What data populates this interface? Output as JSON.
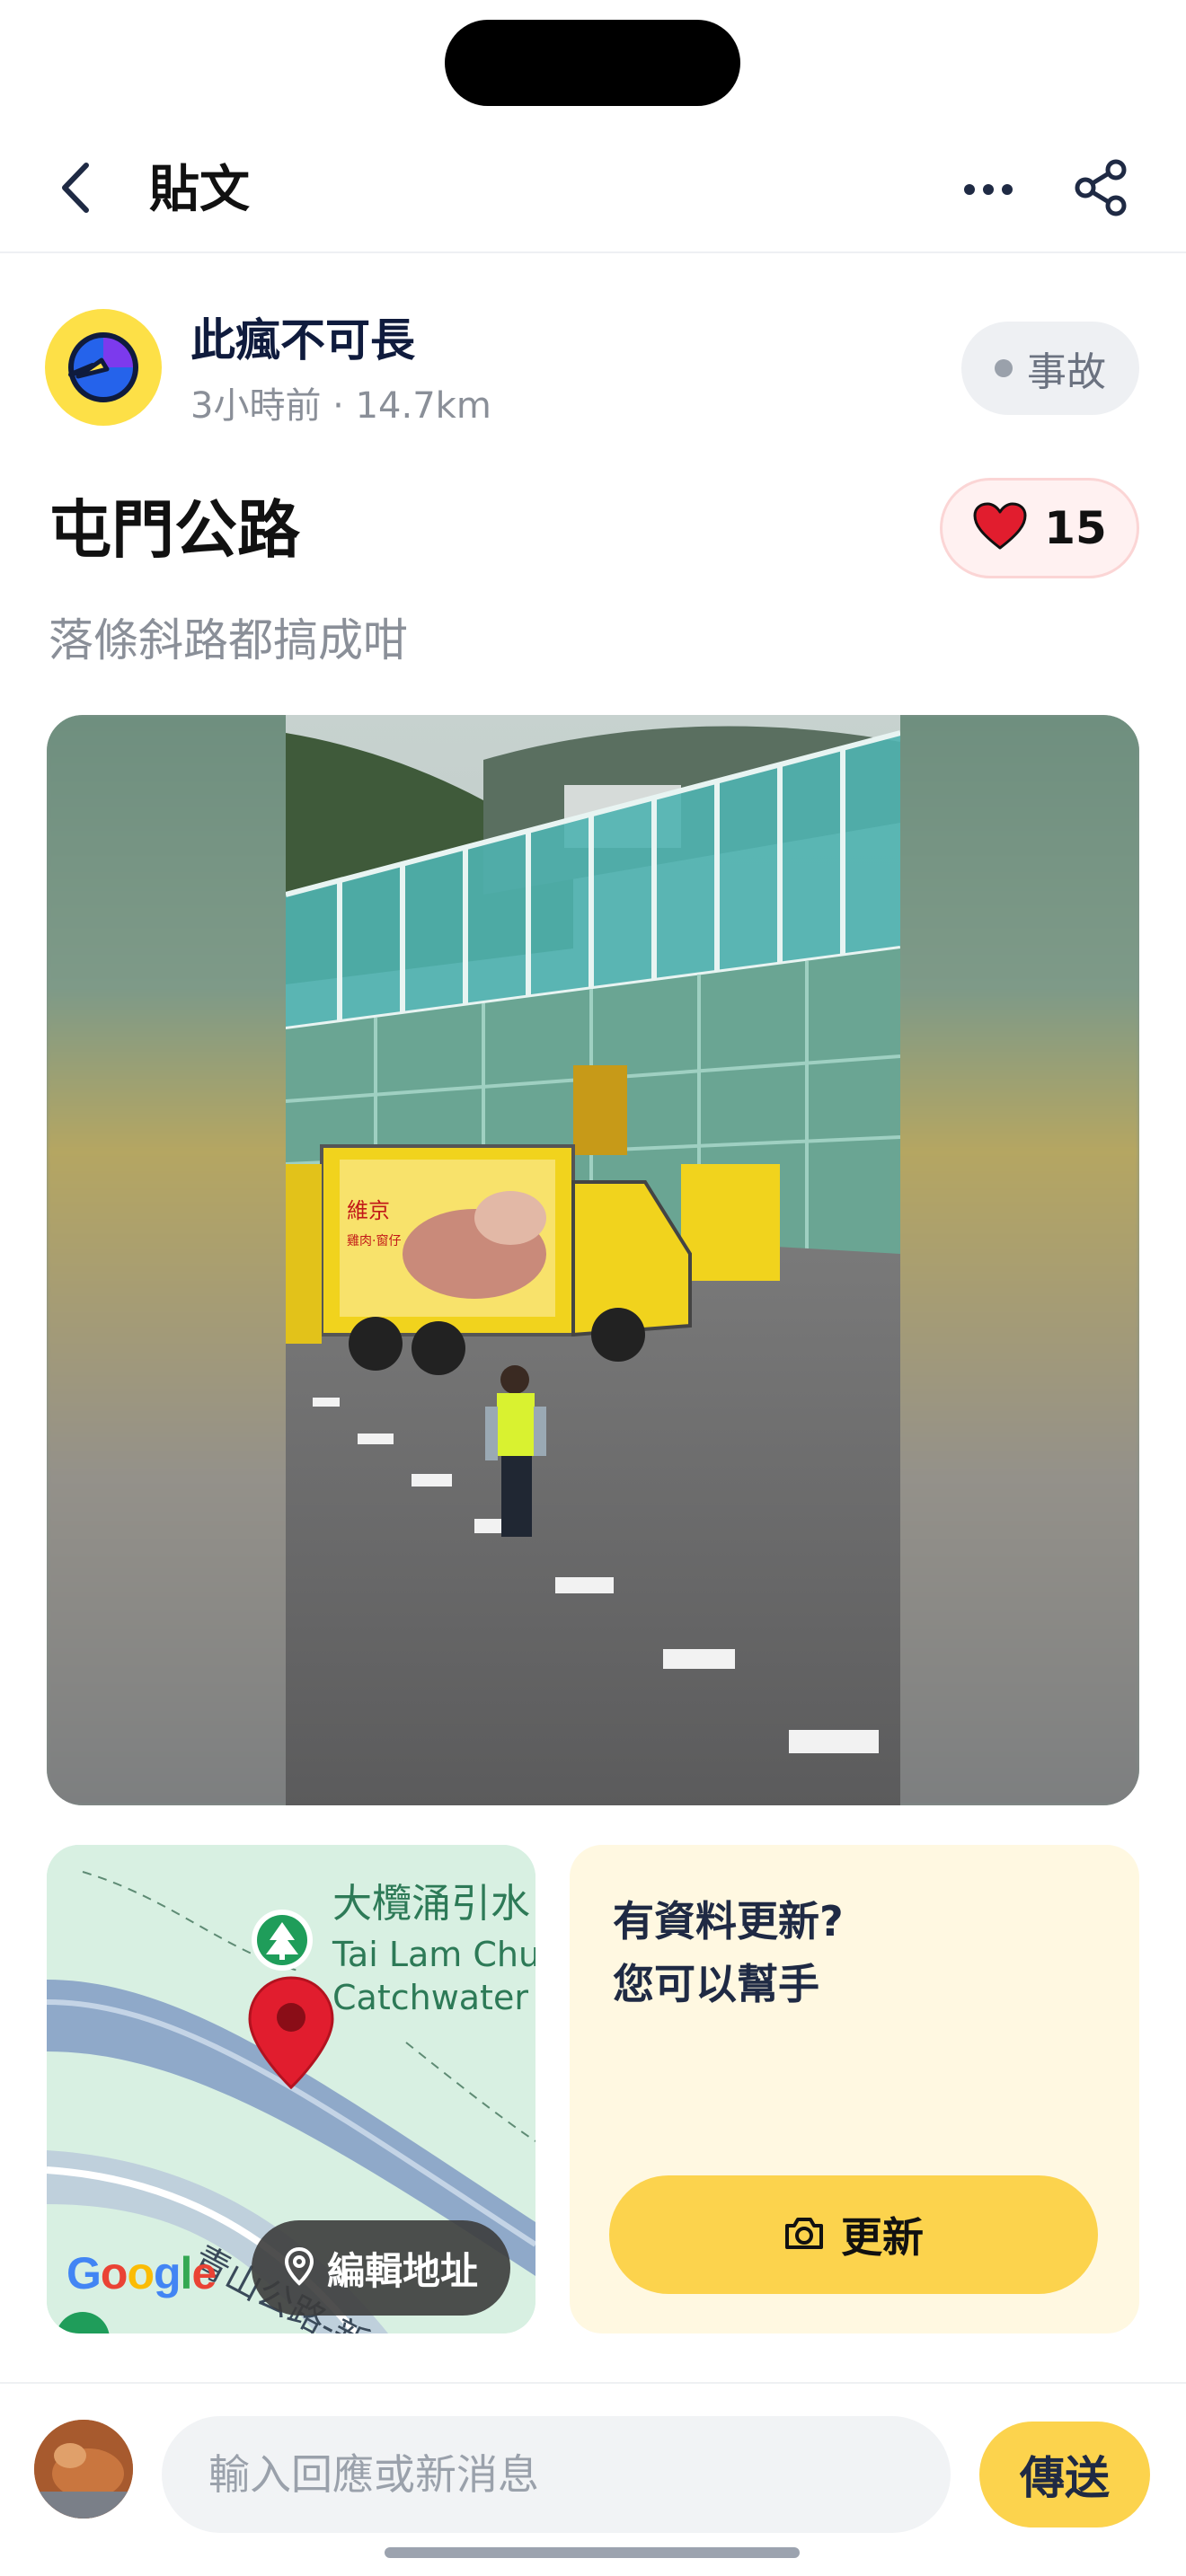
{
  "header": {
    "title": "貼文"
  },
  "author": {
    "name": "此瘋不可長",
    "meta": "3小時前 · 14.7km",
    "tag": "事故"
  },
  "post": {
    "title": "屯門公路",
    "body": "落條斜路都搞成咁",
    "likes": "15"
  },
  "media": {
    "truck_brand_zh": "維京",
    "truck_sub_zh": "雞肉·窗仔"
  },
  "map": {
    "place_zh": "大欖涌引水",
    "place_en_1": "Tai Lam Chu",
    "place_en_2": "Catchwater",
    "road_label": "青山公路-新",
    "google_logo": "Google",
    "edit_address_label": "編輯地址"
  },
  "update_card": {
    "line1": "有資料更新?",
    "line2": "您可以幫手",
    "button_label": "更新"
  },
  "composer": {
    "placeholder": "輸入回應或新消息",
    "send_label": "傳送"
  },
  "colors": {
    "accent_yellow": "#fcd34d",
    "heart_red": "#e11d2e",
    "map_green": "#d8f0e2",
    "pin_red": "#e11d2e"
  },
  "icons": {
    "back": "chevron-left-icon",
    "more": "more-horizontal-icon",
    "share": "share-icon",
    "heart": "heart-icon",
    "camera": "camera-icon",
    "location": "map-pin-icon"
  }
}
